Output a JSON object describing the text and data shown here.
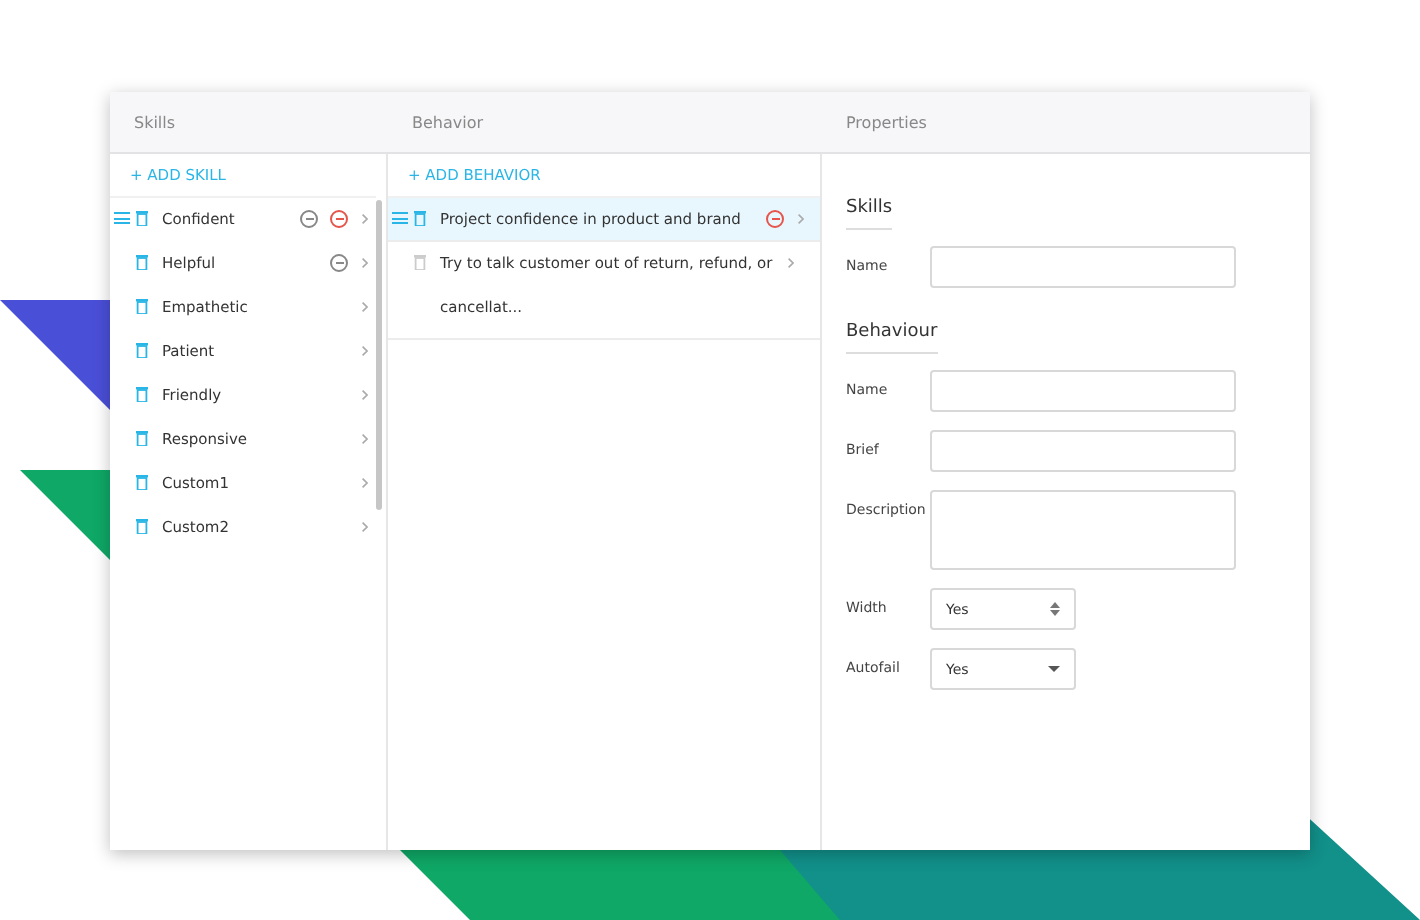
{
  "columns": {
    "skills": "Skills",
    "behavior": "Behavior",
    "properties": "Properties"
  },
  "skills": {
    "add_label": "+ ADD SKILL",
    "items": [
      {
        "name": "Confident",
        "selected": false,
        "handle": true,
        "neutral_flag": true,
        "alert_flag": true
      },
      {
        "name": "Helpful",
        "selected": false,
        "handle": false,
        "neutral_flag": true,
        "alert_flag": false
      },
      {
        "name": "Empathetic",
        "selected": false,
        "handle": false,
        "neutral_flag": false,
        "alert_flag": false
      },
      {
        "name": "Patient",
        "selected": false,
        "handle": false,
        "neutral_flag": false,
        "alert_flag": false
      },
      {
        "name": "Friendly",
        "selected": false,
        "handle": false,
        "neutral_flag": false,
        "alert_flag": false
      },
      {
        "name": "Responsive",
        "selected": false,
        "handle": false,
        "neutral_flag": false,
        "alert_flag": false
      },
      {
        "name": "Custom1",
        "selected": false,
        "handle": false,
        "neutral_flag": false,
        "alert_flag": false
      },
      {
        "name": "Custom2",
        "selected": false,
        "handle": false,
        "neutral_flag": false,
        "alert_flag": false
      }
    ]
  },
  "behavior": {
    "add_label": "+ ADD BEHAVIOR",
    "items": [
      {
        "text": "Project confidence in product and brand",
        "selected": true,
        "handle": true,
        "disabled": false,
        "alert_flag": true
      },
      {
        "text": "Try to talk customer out of return, refund, or cancellat...",
        "selected": false,
        "handle": false,
        "disabled": true,
        "alert_flag": false
      }
    ]
  },
  "properties": {
    "sections": [
      {
        "title": "Skills",
        "fields": [
          {
            "label": "Name",
            "kind": "text"
          }
        ]
      },
      {
        "title": "Behaviour",
        "fields": [
          {
            "label": "Name",
            "kind": "text"
          },
          {
            "label": "Brief",
            "kind": "text"
          },
          {
            "label": "Description",
            "kind": "textarea"
          },
          {
            "label": "Width",
            "kind": "stepper",
            "value": "Yes"
          },
          {
            "label": "Autofail",
            "kind": "dropdown",
            "value": "Yes"
          }
        ]
      }
    ]
  }
}
